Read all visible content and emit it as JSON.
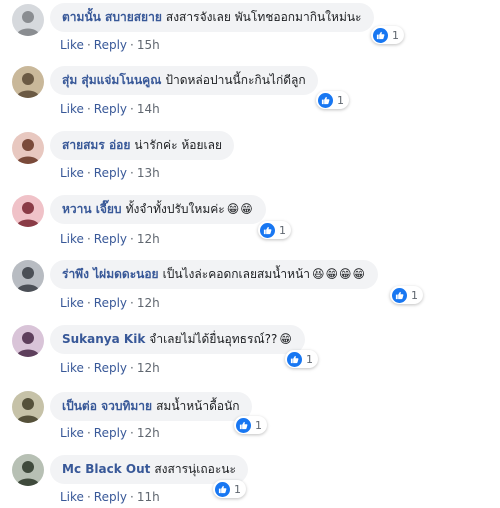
{
  "comments": [
    {
      "author": "ตามนั้น สบายสยาย",
      "text": "สงสารจังเลย พันโทชออกมากินใหม่นะ",
      "emoji": "",
      "like_label": "Like",
      "reply_label": "Reply",
      "time": "15h",
      "reaction_count": "1",
      "avatar_bg": "#d6d9dd",
      "avatar_fg": "#8a8d91"
    },
    {
      "author": "สุ่ม สุ่มแจ่มโนนคูณ",
      "text": "ป้าดหล่อปานนี้กะกินไก่ดีลูก",
      "emoji": "",
      "like_label": "Like",
      "reply_label": "Reply",
      "time": "14h",
      "reaction_count": "1",
      "avatar_bg": "#c9b89a",
      "avatar_fg": "#6b5a44"
    },
    {
      "author": "สายสมร อ่อย",
      "text": "น่ารักค่ะ ห้อยเลย",
      "emoji": "",
      "like_label": "Like",
      "reply_label": "Reply",
      "time": "13h",
      "reaction_count": "",
      "avatar_bg": "#e8c8c0",
      "avatar_fg": "#7a4a3a"
    },
    {
      "author": "หวาน เจี๊ยบ",
      "text": "ทั้งจำทั้งปรับใหมค่ะ",
      "emoji": "😁😁",
      "like_label": "Like",
      "reply_label": "Reply",
      "time": "12h",
      "reaction_count": "1",
      "avatar_bg": "#f0c2c8",
      "avatar_fg": "#8a3b46"
    },
    {
      "author": "ร่าพึง ไผ่มดดะนอย",
      "text": "เป็นไงล่ะคอดกเลยสมน้ำหน้า",
      "emoji": "😆😁😁😁",
      "like_label": "Like",
      "reply_label": "Reply",
      "time": "12h",
      "reaction_count": "1",
      "avatar_bg": "#b8bcc2",
      "avatar_fg": "#4b4f56"
    },
    {
      "author": "Sukanya Kik",
      "text": "จำเลยไม่ได้ยื่นอุทธรณ์??",
      "emoji": "😁",
      "like_label": "Like",
      "reply_label": "Reply",
      "time": "12h",
      "reaction_count": "1",
      "avatar_bg": "#d9c4d8",
      "avatar_fg": "#5e3f5c"
    },
    {
      "author": "เป็นต่อ จวบทิมาย",
      "text": "สมน้ำหน้าดื้อนัก",
      "emoji": "",
      "like_label": "Like",
      "reply_label": "Reply",
      "time": "12h",
      "reaction_count": "1",
      "avatar_bg": "#c6c2a8",
      "avatar_fg": "#55513a"
    },
    {
      "author": "Mc Black Out",
      "text": "สงสารนุ่เถอะนะ",
      "emoji": "",
      "like_label": "Like",
      "reply_label": "Reply",
      "time": "11h",
      "reaction_count": "1",
      "avatar_bg": "#b7c0b4",
      "avatar_fg": "#3f4a3c"
    }
  ],
  "colors": {
    "author": "#385898",
    "bubble": "#f2f3f5",
    "like_badge": "#1877f2",
    "meta": "#606770"
  },
  "icons": {
    "reaction": "like-thumbs-up-icon"
  }
}
